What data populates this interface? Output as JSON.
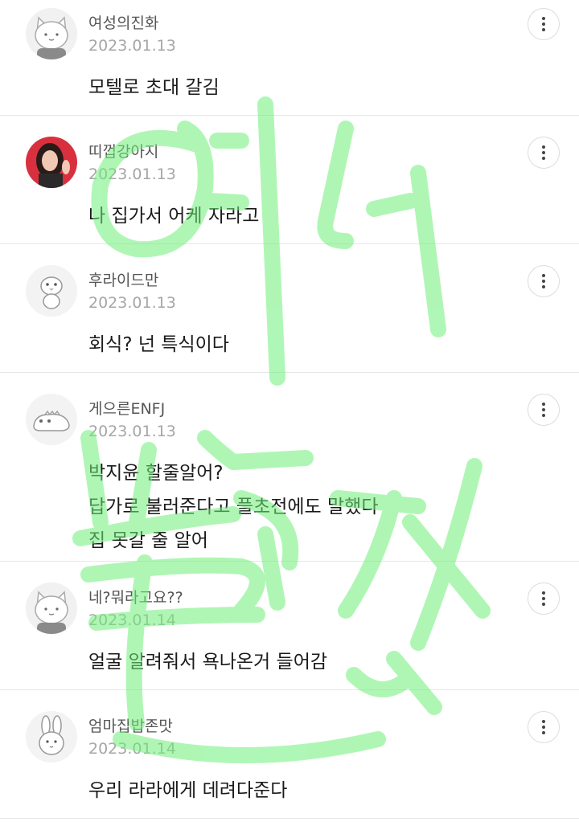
{
  "comments": [
    {
      "author": "여성의진화",
      "date": "2023.01.13",
      "lines": [
        "모텔로 초대 갈김"
      ],
      "avatar_icon": "gray-cat-avatar-icon"
    },
    {
      "author": "띠껍강아지",
      "date": "2023.01.13",
      "lines": [
        "나 집가서 어케 자라고"
      ],
      "avatar_icon": "photo-avatar-icon"
    },
    {
      "author": "후라이드만",
      "date": "2023.01.13",
      "lines": [
        "회식? 넌 특식이다"
      ],
      "avatar_icon": "chick-avatar-icon"
    },
    {
      "author": "게으른ENFJ",
      "date": "2023.01.13",
      "lines": [
        "박지윤 할줄알어?",
        "답가로 불러준다고 플초전에도 말했다",
        "집 못갈 줄 알어"
      ],
      "avatar_icon": "lizard-avatar-icon"
    },
    {
      "author": "네?뭐라고요??",
      "date": "2023.01.14",
      "lines": [
        "얼굴 알려줘서 욕나온거 들어감"
      ],
      "avatar_icon": "gray-cat-avatar-icon"
    },
    {
      "author": "엄마집밥존맛",
      "date": "2023.01.14",
      "lines": [
        "우리 라라에게 데려다준다"
      ],
      "avatar_icon": "bunny-avatar-icon"
    }
  ],
  "more_icon": "more-vertical-icon",
  "watermark_color": "#6ef07a"
}
